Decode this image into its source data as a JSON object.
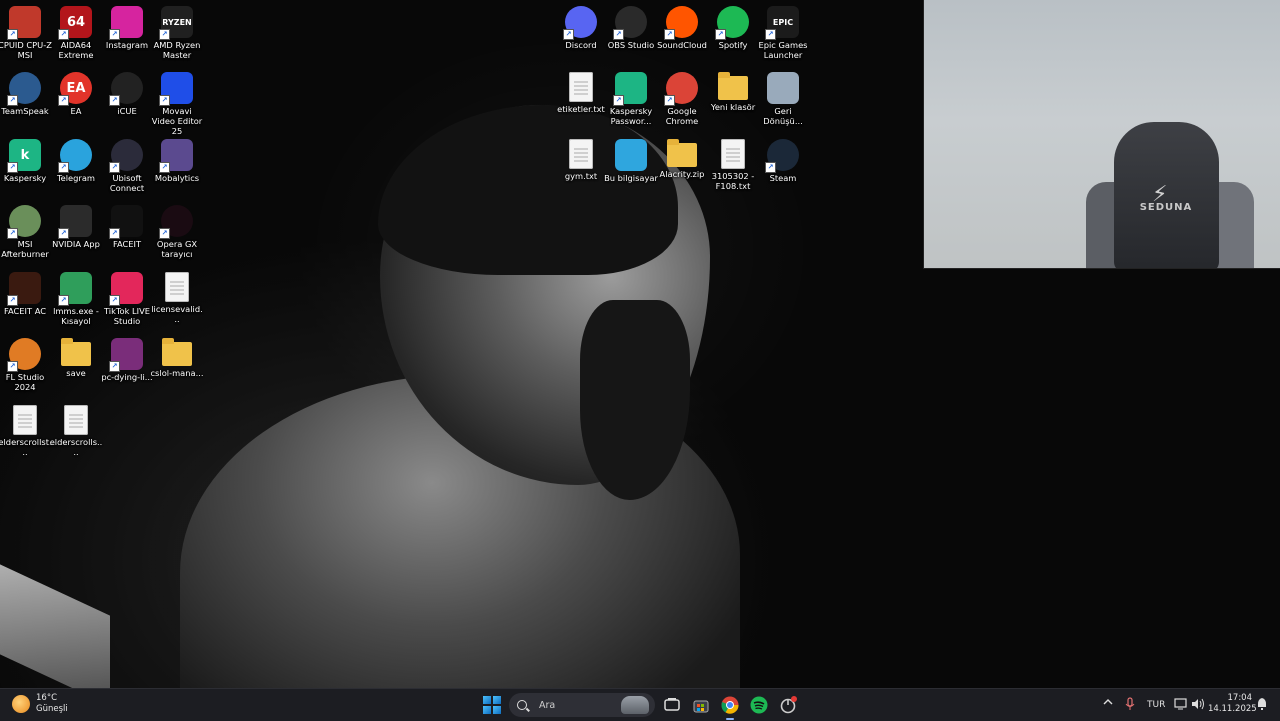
{
  "desktop": {
    "icons": [
      {
        "label": "CPUID CPU-Z MSI",
        "icon": "cpu-z-icon",
        "color": "#c0392b"
      },
      {
        "label": "AIDA64 Extreme",
        "icon": "aida64-icon",
        "color": "#b3151b",
        "glyph": "64"
      },
      {
        "label": "Instagram",
        "icon": "instagram-icon",
        "color": "#d6249f"
      },
      {
        "label": "AMD Ryzen Master",
        "icon": "amd-ryzen-icon",
        "color": "#202020",
        "glyph": "RYZEN"
      },
      {
        "label": "TeamSpeak",
        "icon": "teamspeak-icon",
        "color": "#2b5a8f"
      },
      {
        "label": "EA",
        "icon": "ea-icon",
        "color": "#e2342a",
        "glyph": "EA"
      },
      {
        "label": "iCUE",
        "icon": "icue-icon",
        "color": "#222222"
      },
      {
        "label": "Movavi Video Editor 25",
        "icon": "movavi-icon",
        "color": "#1f4ee8"
      },
      {
        "label": "Kaspersky",
        "icon": "kaspersky-icon",
        "color": "#1db584",
        "glyph": "k"
      },
      {
        "label": "Telegram",
        "icon": "telegram-icon",
        "color": "#2aa3dd"
      },
      {
        "label": "Ubisoft Connect",
        "icon": "ubisoft-icon",
        "color": "#2b2b3a"
      },
      {
        "label": "Mobalytics",
        "icon": "mobalytics-icon",
        "color": "#5b4a8f"
      },
      {
        "label": "MSI Afterburner",
        "icon": "msi-afterburner-icon",
        "color": "#6a8f5a"
      },
      {
        "label": "NVIDIA App",
        "icon": "nvidia-icon",
        "color": "#2b2b2b"
      },
      {
        "label": "FACEIT",
        "icon": "faceit-icon",
        "color": "#111111"
      },
      {
        "label": "Opera GX tarayıcı",
        "icon": "opera-gx-icon",
        "color": "#1a0b12"
      },
      {
        "label": "FACEIT AC",
        "icon": "faceit-ac-icon",
        "color": "#3a1a10"
      },
      {
        "label": "lmms.exe - Kısayol",
        "icon": "lmms-icon",
        "color": "#2f9e5b"
      },
      {
        "label": "TikTok LIVE Studio",
        "icon": "tiktok-icon",
        "color": "#e3275b"
      },
      {
        "label": "licensevalid...",
        "icon": "file-icon",
        "color": "#f4f4f4"
      },
      {
        "label": "FL Studio 2024",
        "icon": "fl-studio-icon",
        "color": "#e07b24"
      },
      {
        "label": "save",
        "icon": "folder-icon",
        "color": "#f0c24a"
      },
      {
        "label": "pc-dying-li...",
        "icon": "winrar-icon",
        "color": "#7a2d7a"
      },
      {
        "label": "cslol-mana...",
        "icon": "folder-icon",
        "color": "#f0c24a"
      },
      {
        "label": "elderscrollst...",
        "icon": "file-icon",
        "color": "#f4f4f4"
      },
      {
        "label": "elderscrolls....",
        "icon": "file-icon",
        "color": "#f4f4f4"
      },
      {
        "label": "Discord",
        "icon": "discord-icon",
        "color": "#5865f2"
      },
      {
        "label": "OBS Studio",
        "icon": "obs-icon",
        "color": "#2a2a2a"
      },
      {
        "label": "SoundCloud",
        "icon": "soundcloud-icon",
        "color": "#ff5500"
      },
      {
        "label": "Spotify",
        "icon": "spotify-icon",
        "color": "#1db954"
      },
      {
        "label": "Epic Games Launcher",
        "icon": "epic-games-icon",
        "color": "#1b1b1b",
        "glyph": "EPIC"
      },
      {
        "label": "etiketler.txt",
        "icon": "file-icon",
        "color": "#f4f4f4"
      },
      {
        "label": "Kaspersky Passwor...",
        "icon": "kaspersky-password-icon",
        "color": "#1db584"
      },
      {
        "label": "Google Chrome",
        "icon": "chrome-icon",
        "color": "#db4437"
      },
      {
        "label": "Yeni klasör",
        "icon": "folder-icon",
        "color": "#f0c24a"
      },
      {
        "label": "Geri Dönüşü...",
        "icon": "recycle-bin-icon",
        "color": "#9ab"
      },
      {
        "label": "gym.txt",
        "icon": "file-icon",
        "color": "#f4f4f4"
      },
      {
        "label": "Bu bilgisayar",
        "icon": "this-pc-icon",
        "color": "#2fa6de"
      },
      {
        "label": "Alacrity.zip",
        "icon": "zip-folder-icon",
        "color": "#f0c24a"
      },
      {
        "label": "3105302 - F108.txt",
        "icon": "file-icon",
        "color": "#f4f4f4"
      },
      {
        "label": "Steam",
        "icon": "steam-icon",
        "color": "#1b2838"
      }
    ]
  },
  "webcam": {
    "chair_brand": "SEDUNA"
  },
  "taskbar": {
    "weather": {
      "temp": "16°C",
      "condition": "Güneşli"
    },
    "search_placeholder": "Ara",
    "language": "TUR",
    "time": "17:04",
    "date": "14.11.2025",
    "accent": "#8ab4f8"
  }
}
